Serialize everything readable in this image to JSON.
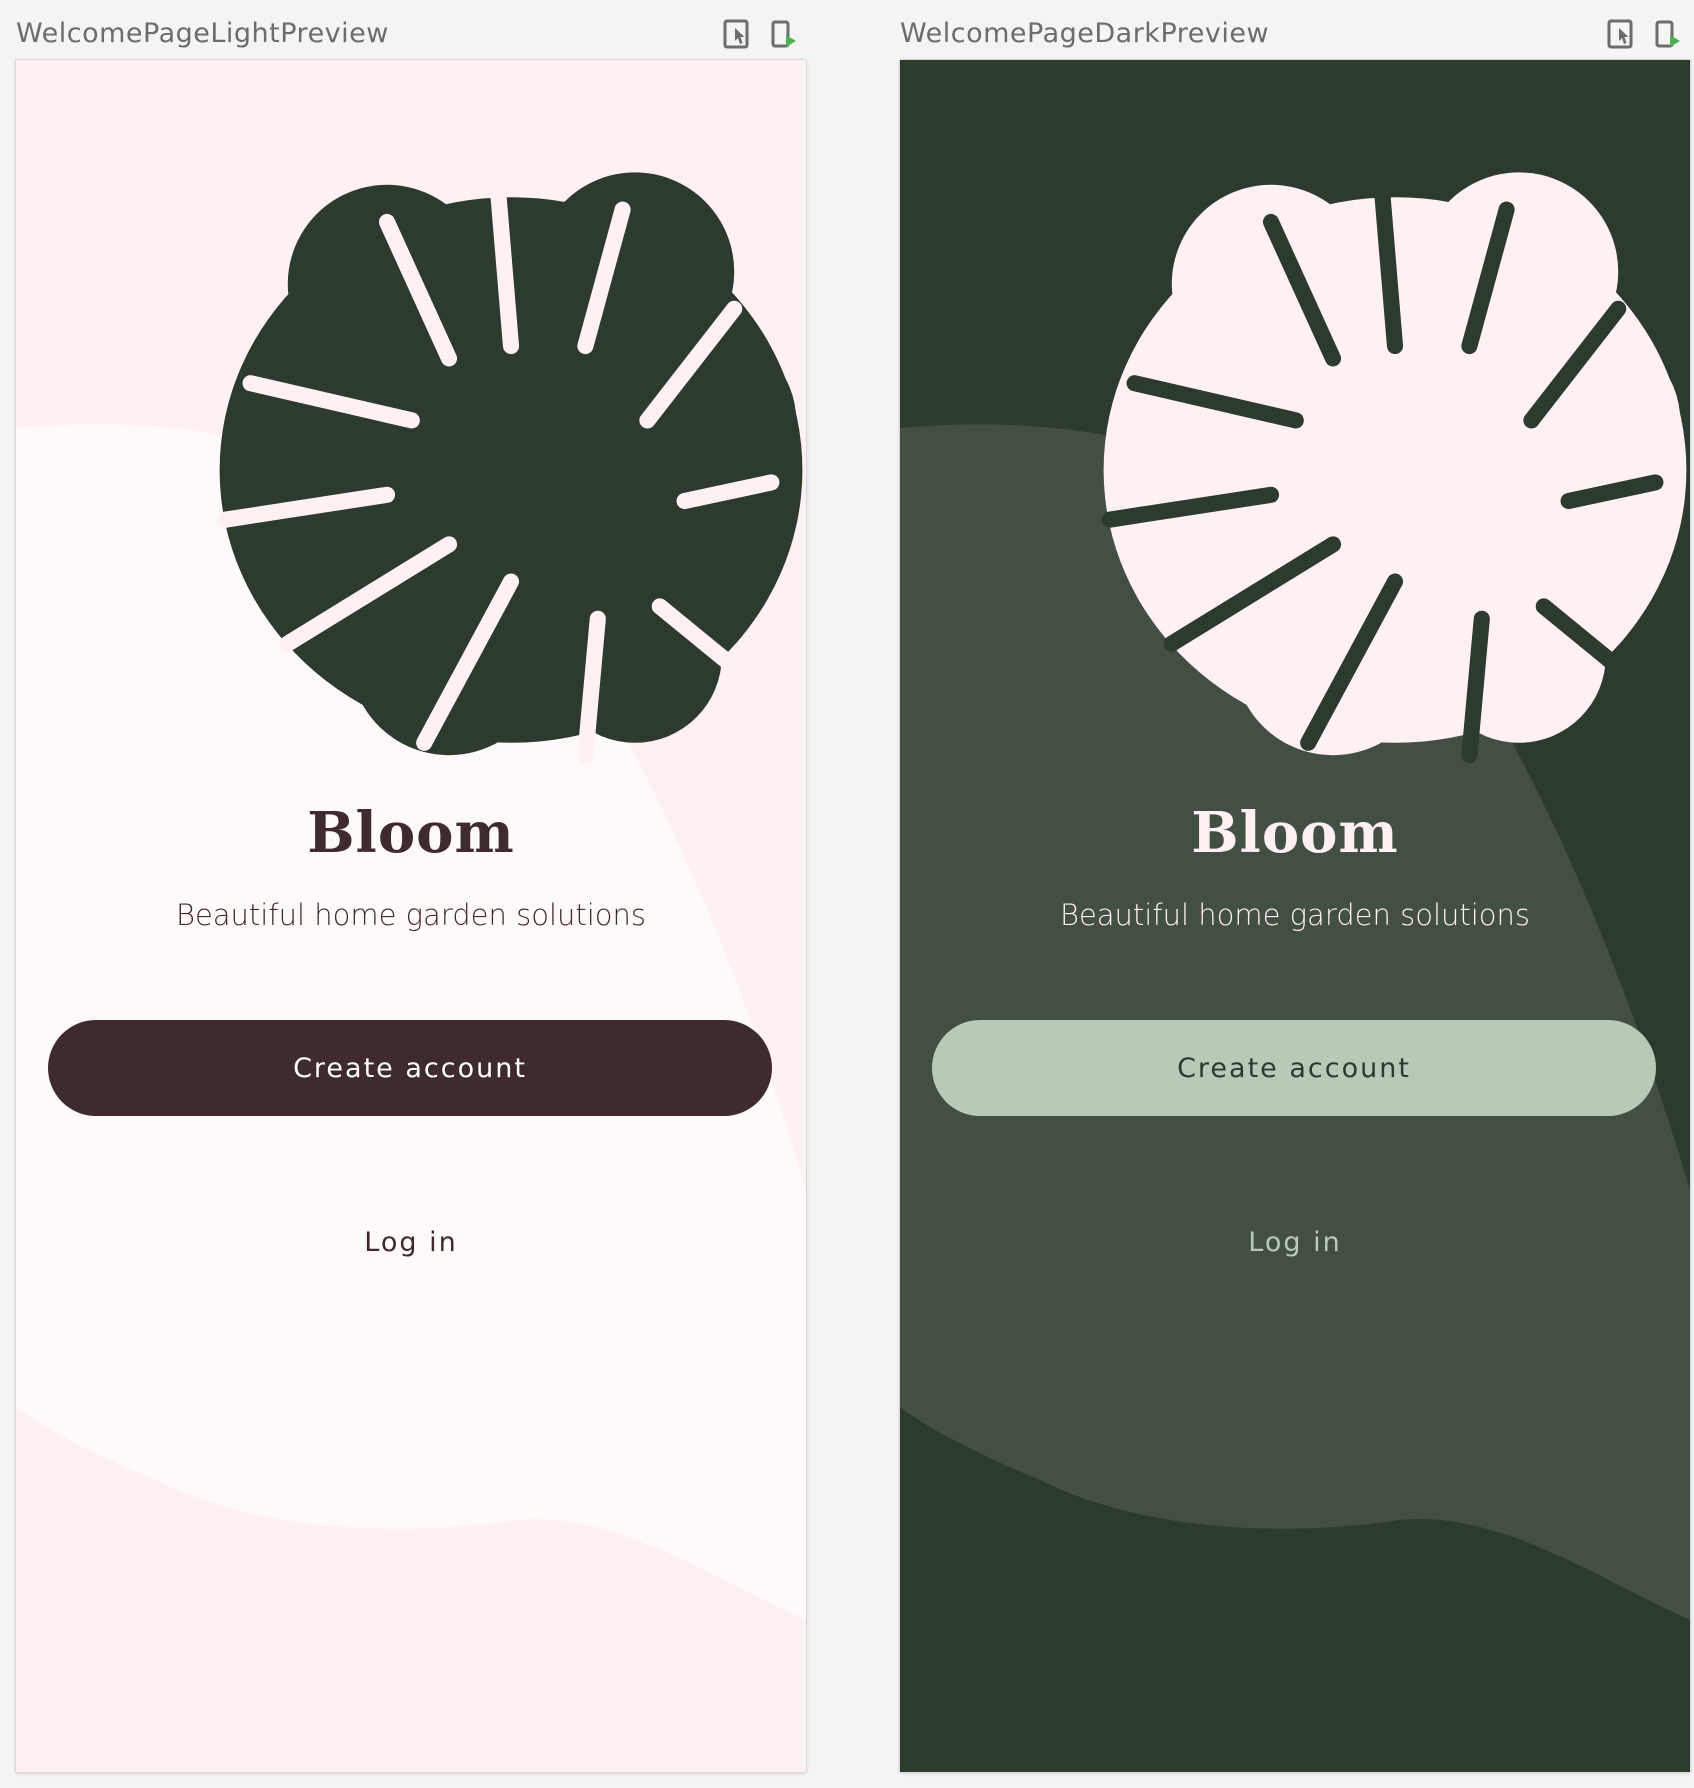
{
  "previews": [
    {
      "name": "WelcomePageLightPreview",
      "theme": "light",
      "title": "Bloom",
      "subtitle": "Beautiful home garden solutions",
      "primary_button": "Create account",
      "secondary_button": "Log in",
      "icons": [
        "interactive-mode-icon",
        "deploy-preview-icon"
      ],
      "colors": {
        "background": "#fff1f1",
        "surface_shape": "#fffafa",
        "leaf": "#2d3a2e",
        "text": "#3f2b2c",
        "button_bg": "#3f2b2c",
        "button_text": "#ffffff"
      }
    },
    {
      "name": "WelcomePageDarkPreview",
      "theme": "dark",
      "title": "Bloom",
      "subtitle": "Beautiful home garden solutions",
      "primary_button": "Create account",
      "secondary_button": "Log in",
      "icons": [
        "interactive-mode-icon",
        "deploy-preview-icon"
      ],
      "colors": {
        "background": "#2d3a2e",
        "surface_shape": "#444f44",
        "leaf": "#fff1f1",
        "text": "#fff1f1",
        "button_bg": "#b8c9b8",
        "button_text": "#2d3a2e"
      }
    }
  ],
  "accent_colors": {
    "deploy_arrow": "#4caf50",
    "toolbar_icon": "#6c6c6c"
  }
}
